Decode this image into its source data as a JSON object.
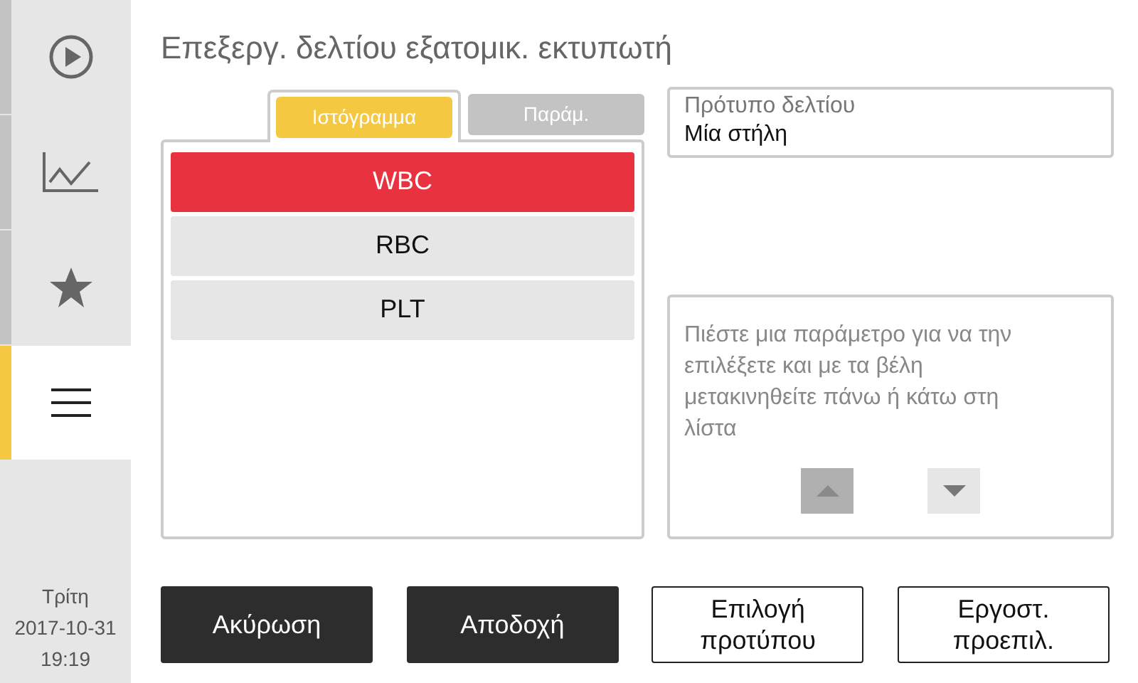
{
  "sidebar": {
    "items": [
      {
        "kind": "play",
        "selected": false
      },
      {
        "kind": "chart",
        "selected": false
      },
      {
        "kind": "star",
        "selected": false
      },
      {
        "kind": "menu",
        "selected": true
      }
    ],
    "day": "Τρίτη",
    "date": "2017-10-31",
    "time": "19:19"
  },
  "title": "Επεξεργ. δελτίου εξατομικ. εκτυπωτή",
  "tabs": [
    {
      "label": "Ιστόγραμμα",
      "selected": true
    },
    {
      "label": "Παράμ.",
      "selected": false
    }
  ],
  "list": [
    {
      "label": "WBC",
      "selected": true
    },
    {
      "label": "RBC",
      "selected": false
    },
    {
      "label": "PLT",
      "selected": false
    }
  ],
  "template": {
    "label": "Πρότυπο δελτίου",
    "value": "Μία στήλη"
  },
  "hint": "Πιέστε μια παράμετρο για να την επιλέξετε και με τα βέλη μετακινηθείτε πάνω ή κάτω στη λίστα",
  "arrows": [
    {
      "kind": "up",
      "disabled": true
    },
    {
      "kind": "down",
      "disabled": false
    }
  ],
  "buttons": [
    {
      "label": "Ακύρωση",
      "kind": "dark"
    },
    {
      "label": "Αποδοχή",
      "kind": "dark"
    },
    {
      "label": "Επιλογή προτύπου",
      "kind": "outline"
    },
    {
      "label": "Εργοστ. προεπιλ.",
      "kind": "outline"
    }
  ]
}
